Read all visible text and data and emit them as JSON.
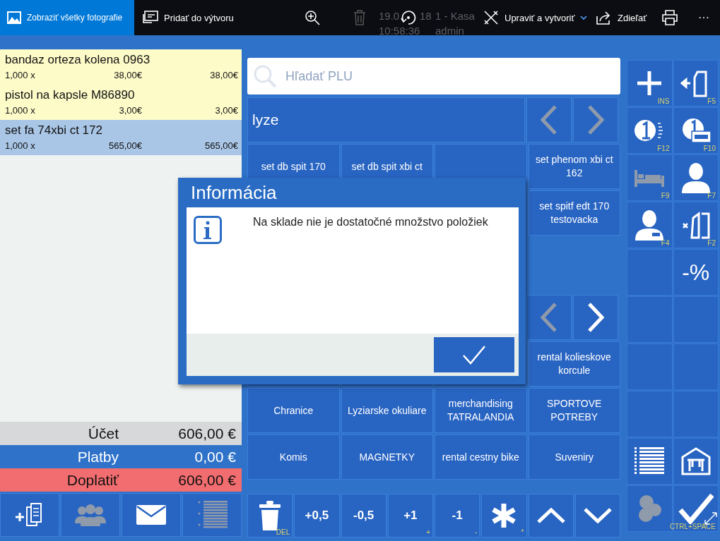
{
  "viewer_toolbar": {
    "tabs": [
      {
        "label": "Zobraziť všetky fotografie",
        "selected": true
      },
      {
        "label": "Pridať do výtvoru",
        "selected": false
      }
    ],
    "tools": [
      {
        "kind": "zoom",
        "disabled": false
      },
      {
        "kind": "trash",
        "disabled": true
      },
      {
        "kind": "rotate",
        "disabled": false
      }
    ],
    "edit": {
      "label": "Upraviť a vytvoriť"
    },
    "share": {
      "label": "Zdieľať"
    },
    "more": "···"
  },
  "pos_header": {
    "date_parts": [
      "19.0",
      "18"
    ],
    "register": "1 - Kasa",
    "time": "10:58:36",
    "user": "admin"
  },
  "receipt": {
    "items": [
      {
        "name": "bandaz orteza kolena 0963",
        "qty": "1,000 x",
        "price": "38,00€",
        "total": "38,00€",
        "selected": false
      },
      {
        "name": "pistol na kapsle M86890",
        "qty": "1,000 x",
        "price": "3,00€",
        "total": "3,00€",
        "selected": false
      },
      {
        "name": "set fa 74xbi ct 172",
        "qty": "1,000 x",
        "price": "565,00€",
        "total": "565,00€",
        "selected": true
      }
    ],
    "totals": [
      {
        "kind": "bill",
        "label": "Účet",
        "value": "606,00 €"
      },
      {
        "kind": "paid",
        "label": "Platby",
        "value": "0,00 €"
      },
      {
        "kind": "due",
        "label": "Doplatiť",
        "value": "606,00 €"
      }
    ],
    "buttons": [
      {
        "kind": "copy",
        "disabled": false
      },
      {
        "kind": "people",
        "disabled": true
      },
      {
        "kind": "mail",
        "disabled": false
      },
      {
        "kind": "numbered-list",
        "disabled": true
      }
    ]
  },
  "search": {
    "placeholder": "Hľadať PLU"
  },
  "category": {
    "label": "lyze",
    "prev_disabled": true,
    "next_disabled": true
  },
  "products_top": [
    {
      "kind": "product",
      "label": "set db spit 170"
    },
    {
      "kind": "product",
      "label": "set db spit xbi ct"
    },
    {
      "kind": "blank"
    },
    {
      "kind": "product",
      "label": "set phenom xbi ct 162"
    },
    {
      "kind": "product",
      "label": "set spitf edt 170 testovacka"
    }
  ],
  "pager": {
    "prev_disabled": true,
    "next_disabled": false
  },
  "products_bottom": [
    {
      "kind": "blank"
    },
    {
      "kind": "blank"
    },
    {
      "kind": "blank"
    },
    {
      "kind": "product",
      "label": "rental kolieskove korcule"
    },
    {
      "kind": "product",
      "label": "Chranice"
    },
    {
      "kind": "product",
      "label": "Lyziarske okuliare"
    },
    {
      "kind": "product",
      "label": "merchandising TATRALANDIA"
    },
    {
      "kind": "product",
      "label": "SPORTOVE POTREBY"
    },
    {
      "kind": "product",
      "label": "Komis"
    },
    {
      "kind": "product",
      "label": "MAGNETKY"
    },
    {
      "kind": "product",
      "label": "rental cestny bike"
    },
    {
      "kind": "product",
      "label": "Suveniry"
    }
  ],
  "actions": [
    {
      "kind": "trash",
      "key": "DEL"
    },
    {
      "kind": "text",
      "label": "+0,5"
    },
    {
      "kind": "text",
      "label": "-0,5"
    },
    {
      "kind": "text",
      "label": "+1",
      "key": "+"
    },
    {
      "kind": "text",
      "label": "-1",
      "key": "-"
    },
    {
      "kind": "asterisk",
      "key": "*"
    },
    {
      "kind": "up"
    },
    {
      "kind": "down"
    }
  ],
  "side_buttons": [
    {
      "kind": "plus",
      "key": "INS",
      "disabled": false
    },
    {
      "kind": "doc-arrow",
      "key": "F5",
      "disabled": false
    },
    {
      "kind": "coin",
      "key": "F12",
      "disabled": false
    },
    {
      "kind": "card",
      "key": "F10",
      "disabled": false
    },
    {
      "kind": "bed",
      "key": "F9",
      "disabled": true
    },
    {
      "kind": "person",
      "key": "F7",
      "disabled": false
    },
    {
      "kind": "cashier",
      "key": "F4",
      "disabled": false
    },
    {
      "kind": "torn-doc",
      "key": "F2",
      "disabled": false
    },
    {
      "kind": "empty"
    },
    {
      "kind": "text",
      "label": "-%",
      "disabled": false
    },
    {
      "kind": "empty"
    },
    {
      "kind": "empty"
    },
    {
      "kind": "empty"
    },
    {
      "kind": "empty"
    },
    {
      "kind": "empty"
    },
    {
      "kind": "empty"
    },
    {
      "kind": "list",
      "disabled": false
    },
    {
      "kind": "house",
      "disabled": false
    },
    {
      "kind": "coins",
      "disabled": true
    },
    {
      "kind": "check",
      "key": "CTRL+SPACE",
      "disabled": false
    }
  ],
  "dialog": {
    "title": "Informácia",
    "message": "Na sklade nie je dostatočné množstvo položiek"
  }
}
